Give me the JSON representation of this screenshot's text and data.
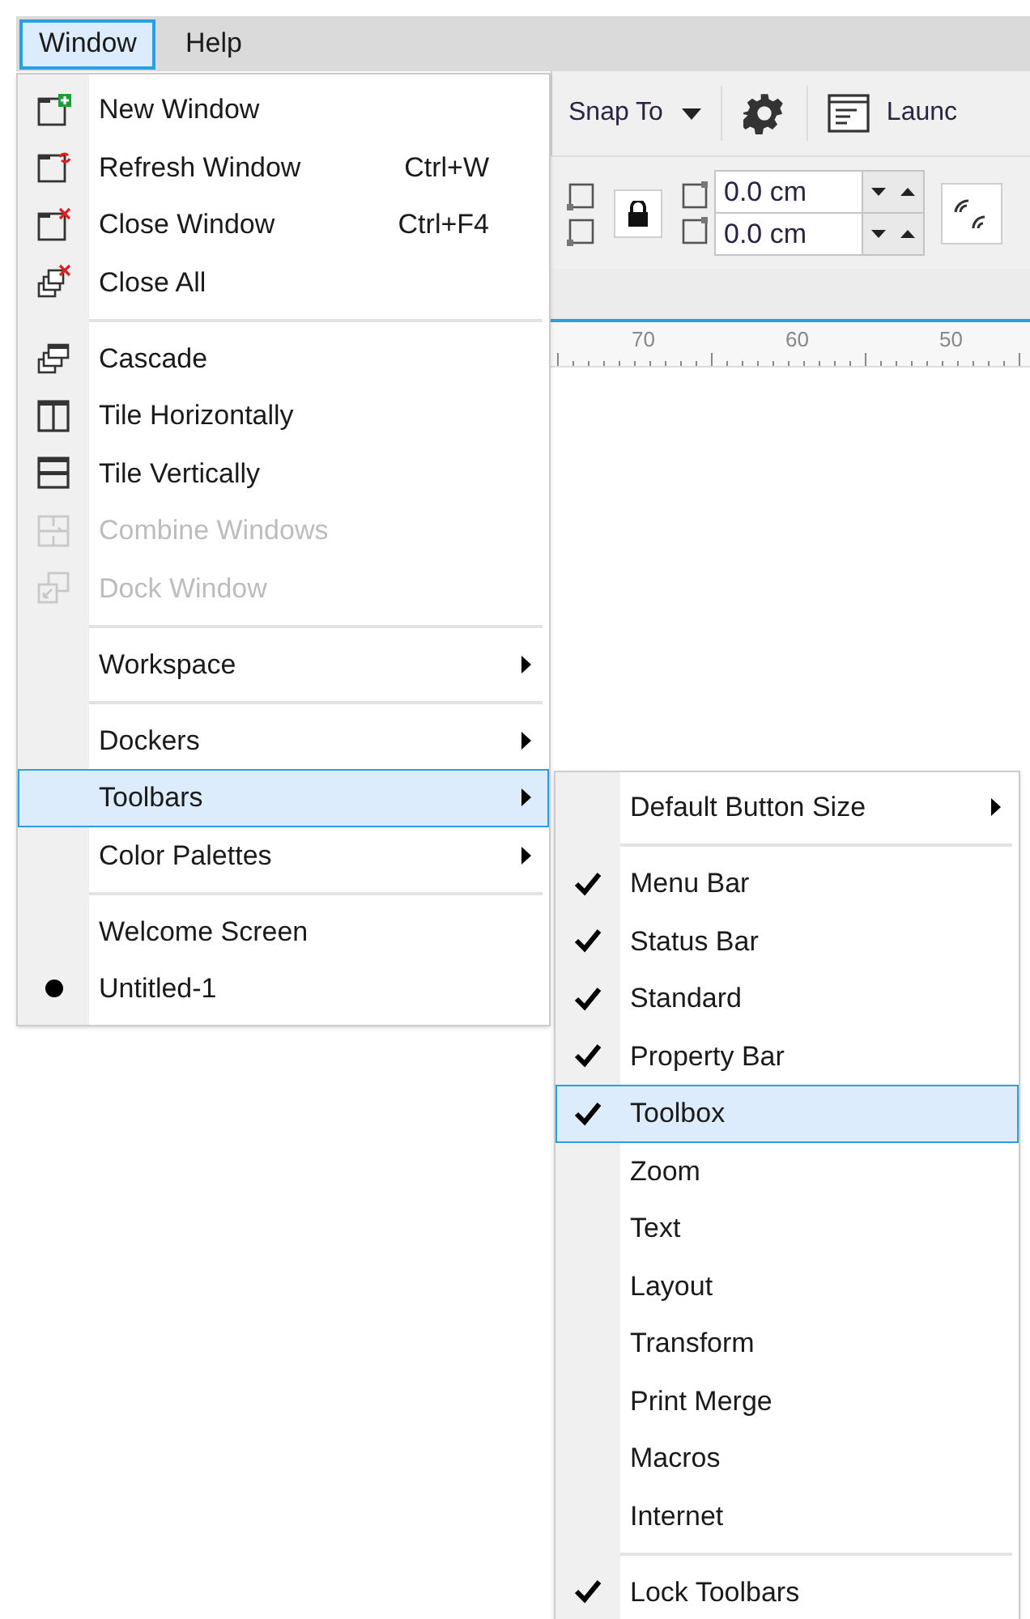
{
  "menu_bar": [
    {
      "label": "Window",
      "selected": true
    },
    {
      "label": "Help",
      "selected": false
    }
  ],
  "toolbar": {
    "snap_to": {
      "label": "Snap To"
    },
    "launch": {
      "label": "Launc"
    }
  },
  "property_bar": {
    "fields": [
      {
        "value": "0.0 cm"
      },
      {
        "value": "0.0 cm"
      }
    ]
  },
  "ruler": {
    "labels": [
      "70",
      "60",
      "50"
    ]
  },
  "window_menu": {
    "items": [
      {
        "kind": "item",
        "label": "New Window",
        "disabled": false,
        "checked": false,
        "selected": false,
        "submenu": false
      },
      {
        "kind": "item",
        "label": "Refresh Window",
        "shortcut": "Ctrl+W",
        "disabled": false,
        "checked": false,
        "selected": false,
        "submenu": false
      },
      {
        "kind": "item",
        "label": "Close Window",
        "shortcut": "Ctrl+F4",
        "disabled": false,
        "checked": false,
        "selected": false,
        "submenu": false
      },
      {
        "kind": "item",
        "label": "Close All",
        "disabled": false,
        "checked": false,
        "selected": false,
        "submenu": false
      },
      {
        "kind": "separator"
      },
      {
        "kind": "item",
        "label": "Cascade",
        "disabled": false,
        "checked": false,
        "selected": false,
        "submenu": false
      },
      {
        "kind": "item",
        "label": "Tile Horizontally",
        "disabled": false,
        "checked": false,
        "selected": false,
        "submenu": false
      },
      {
        "kind": "item",
        "label": "Tile Vertically",
        "disabled": false,
        "checked": false,
        "selected": false,
        "submenu": false
      },
      {
        "kind": "item",
        "label": "Combine Windows",
        "disabled": true,
        "checked": false,
        "selected": false,
        "submenu": false
      },
      {
        "kind": "item",
        "label": "Dock Window",
        "disabled": true,
        "checked": false,
        "selected": false,
        "submenu": false
      },
      {
        "kind": "separator"
      },
      {
        "kind": "item",
        "label": "Workspace",
        "disabled": false,
        "checked": false,
        "selected": false,
        "submenu": true
      },
      {
        "kind": "separator"
      },
      {
        "kind": "item",
        "label": "Dockers",
        "disabled": false,
        "checked": false,
        "selected": false,
        "submenu": true
      },
      {
        "kind": "item",
        "label": "Toolbars",
        "disabled": false,
        "checked": false,
        "selected": true,
        "submenu": true
      },
      {
        "kind": "item",
        "label": "Color Palettes",
        "disabled": false,
        "checked": false,
        "selected": false,
        "submenu": true
      },
      {
        "kind": "separator"
      },
      {
        "kind": "item",
        "label": "Welcome Screen",
        "disabled": false,
        "checked": false,
        "selected": false,
        "submenu": false
      },
      {
        "kind": "item",
        "label": "Untitled-1",
        "disabled": false,
        "checked": true,
        "selected": false,
        "submenu": false
      }
    ]
  },
  "toolbars_menu": {
    "items": [
      {
        "kind": "item",
        "label": "Default Button Size",
        "checked": false,
        "selected": false,
        "submenu": true
      },
      {
        "kind": "separator"
      },
      {
        "kind": "item",
        "label": "Menu Bar",
        "checked": true,
        "selected": false,
        "submenu": false
      },
      {
        "kind": "item",
        "label": "Status Bar",
        "checked": true,
        "selected": false,
        "submenu": false
      },
      {
        "kind": "item",
        "label": "Standard",
        "checked": true,
        "selected": false,
        "submenu": false
      },
      {
        "kind": "item",
        "label": "Property Bar",
        "checked": true,
        "selected": false,
        "submenu": false
      },
      {
        "kind": "item",
        "label": "Toolbox",
        "checked": true,
        "selected": true,
        "submenu": false
      },
      {
        "kind": "item",
        "label": "Zoom",
        "checked": false,
        "selected": false,
        "submenu": false
      },
      {
        "kind": "item",
        "label": "Text",
        "checked": false,
        "selected": false,
        "submenu": false
      },
      {
        "kind": "item",
        "label": "Layout",
        "checked": false,
        "selected": false,
        "submenu": false
      },
      {
        "kind": "item",
        "label": "Transform",
        "checked": false,
        "selected": false,
        "submenu": false
      },
      {
        "kind": "item",
        "label": "Print Merge",
        "checked": false,
        "selected": false,
        "submenu": false
      },
      {
        "kind": "item",
        "label": "Macros",
        "checked": false,
        "selected": false,
        "submenu": false
      },
      {
        "kind": "item",
        "label": "Internet",
        "checked": false,
        "selected": false,
        "submenu": false
      },
      {
        "kind": "separator"
      },
      {
        "kind": "item",
        "label": "Lock Toolbars",
        "checked": true,
        "selected": false,
        "submenu": false
      }
    ]
  }
}
